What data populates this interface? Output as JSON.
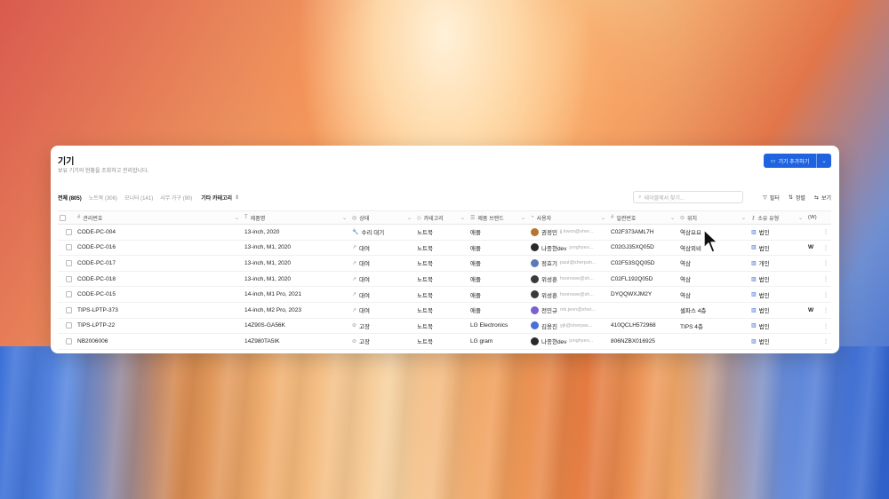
{
  "header": {
    "title": "기기",
    "subtitle": "보유 기기의 현황을 조회하고 관리합니다.",
    "add_button": "기기 추가하기"
  },
  "tabs": [
    {
      "label": "전체 (805)",
      "active": true
    },
    {
      "label": "노트북 (306)",
      "active": false
    },
    {
      "label": "모니터 (141)",
      "active": false
    },
    {
      "label": "사무 가구 (90)",
      "active": false
    }
  ],
  "category_button": "기타 카테고리",
  "search": {
    "placeholder": "테이블에서 찾기..."
  },
  "toolbar": {
    "filter": "필터",
    "sort": "정렬",
    "view": "보기"
  },
  "columns": {
    "id": "관리번호",
    "model": "제품명",
    "state": "상태",
    "category": "카테고리",
    "brand": "제품 브랜드",
    "user": "사용자",
    "serial": "일련번호",
    "location": "위치",
    "ownership": "소유 유형",
    "extra": "(W)"
  },
  "rows": [
    {
      "id": "CODE-PC-004",
      "model": "13-inch, 2020",
      "state": "수리 대기",
      "category": "노트북",
      "brand": "애플",
      "user": "권정민",
      "email": "jj.kwon@sher...",
      "serial": "C02F373AML7H",
      "location": "역삼요요",
      "ownership": "법인",
      "extra": ""
    },
    {
      "id": "CODE-PC-016",
      "model": "13-inch, M1, 2020",
      "state": "대여",
      "category": "노트북",
      "brand": "애플",
      "user": "나종현dev",
      "email": "jonghyeo...",
      "serial": "C02GJ35XQ05D",
      "location": "역삼외비",
      "ownership": "법인",
      "extra": "W"
    },
    {
      "id": "CODE-PC-017",
      "model": "13-inch, M1, 2020",
      "state": "대여",
      "category": "노트북",
      "brand": "애플",
      "user": "정효기",
      "email": "paul@sherpah...",
      "serial": "C02F53SQQ05D",
      "location": "역삼",
      "ownership": "개인",
      "extra": ""
    },
    {
      "id": "CODE-PC-018",
      "model": "13-inch, M1, 2020",
      "state": "대여",
      "category": "노트북",
      "brand": "애플",
      "user": "위성훈",
      "email": "hoonswe@sh...",
      "serial": "C02FL192Q05D",
      "location": "역삼",
      "ownership": "법인",
      "extra": ""
    },
    {
      "id": "CODE-PC-015",
      "model": "14-inch, M1 Pro, 2021",
      "state": "대여",
      "category": "노트북",
      "brand": "애플",
      "user": "위성훈",
      "email": "hoonswe@sh...",
      "serial": "DYQQWXJM2Y",
      "location": "역삼",
      "ownership": "법인",
      "extra": ""
    },
    {
      "id": "TIPS-LPTP-373",
      "model": "14-inch, M2 Pro, 2023",
      "state": "대여",
      "category": "노트북",
      "brand": "애플",
      "user": "전민규",
      "email": "mk.jeon@sher...",
      "serial": "",
      "location": "셀파스 4층",
      "ownership": "법인",
      "extra": "W"
    },
    {
      "id": "TIPS-LPTP-22",
      "model": "14Z90S-GA56K",
      "state": "고장",
      "category": "노트북",
      "brand": "LG Electronics",
      "user": "김용진",
      "email": "yjk@sherpas...",
      "serial": "410QCLH572968",
      "location": "TIPS 4층",
      "ownership": "법인",
      "extra": ""
    },
    {
      "id": "NB2006006",
      "model": "14Z980TA5IK",
      "state": "고장",
      "category": "노트북",
      "brand": "LG gram",
      "user": "나종현dev",
      "email": "jonghyeo...",
      "serial": "806NZBX016925",
      "location": "",
      "ownership": "법인",
      "extra": ""
    }
  ],
  "icons": {
    "search": "search-icon",
    "filter": "filter-icon",
    "sort": "sort-icon",
    "view": "view-icon",
    "monitor": "monitor-icon"
  },
  "colors": {
    "accent": "#1f63e0",
    "repair": "#e0a020"
  }
}
